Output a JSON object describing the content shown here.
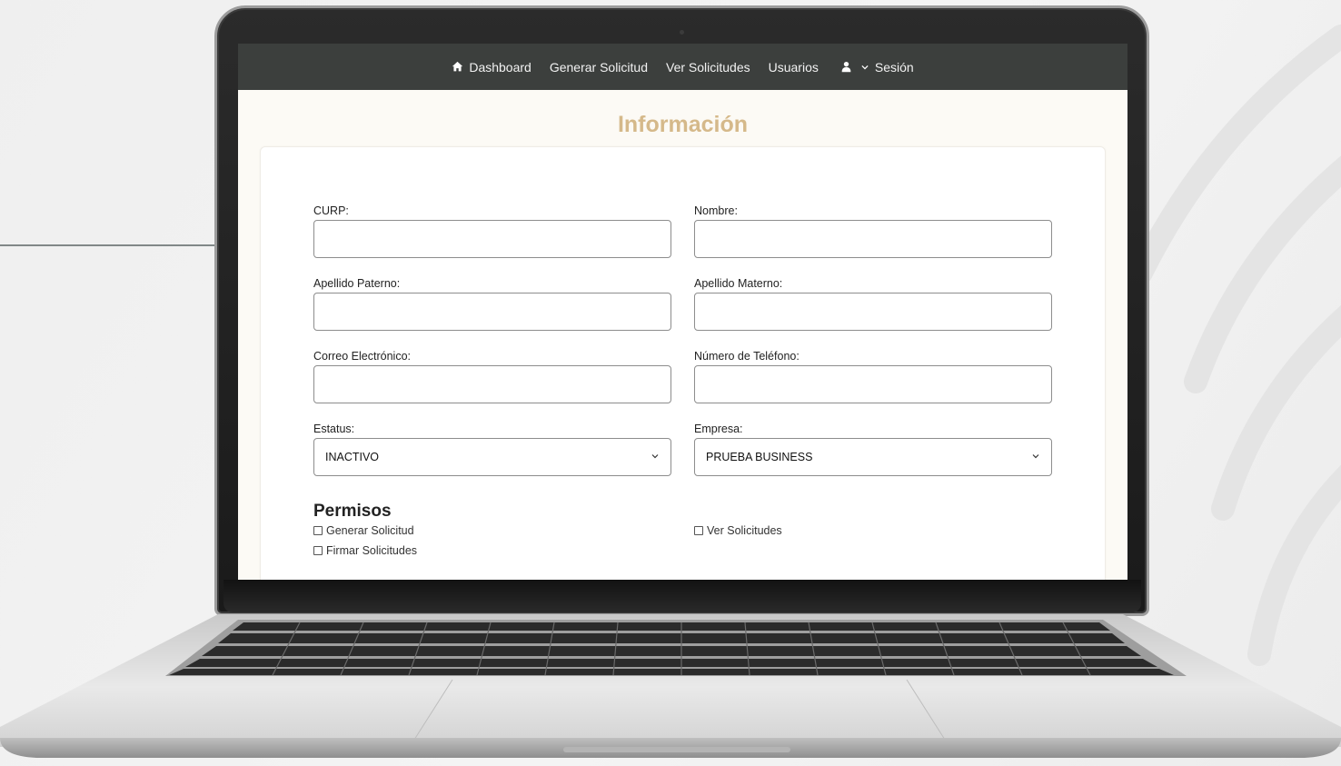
{
  "nav": {
    "items": [
      {
        "label": "Dashboard",
        "icon": "home-icon"
      },
      {
        "label": "Generar Solicitud"
      },
      {
        "label": "Ver Solicitudes"
      },
      {
        "label": "Usuarios"
      },
      {
        "label": "Sesión",
        "icon": "user-icon"
      }
    ]
  },
  "page": {
    "title": "Información"
  },
  "form": {
    "curp_label": "CURP:",
    "nombre_label": "Nombre:",
    "apellido_paterno_label": "Apellido Paterno:",
    "apellido_materno_label": "Apellido Materno:",
    "correo_label": "Correo Electrónico:",
    "telefono_label": "Número de Teléfono:",
    "estatus_label": "Estatus:",
    "estatus_value": "INACTIVO",
    "empresa_label": "Empresa:",
    "empresa_value": "PRUEBA BUSINESS"
  },
  "permisos": {
    "title": "Permisos",
    "items": [
      {
        "label": "Generar Solicitud",
        "checked": false
      },
      {
        "label": "Ver Solicitudes",
        "checked": false
      },
      {
        "label": "Firmar Solicitudes",
        "checked": false
      }
    ]
  },
  "colors": {
    "navbar": "#3c3f3d",
    "title": "#d5b98a",
    "screen_bg": "#fcfaf5"
  }
}
